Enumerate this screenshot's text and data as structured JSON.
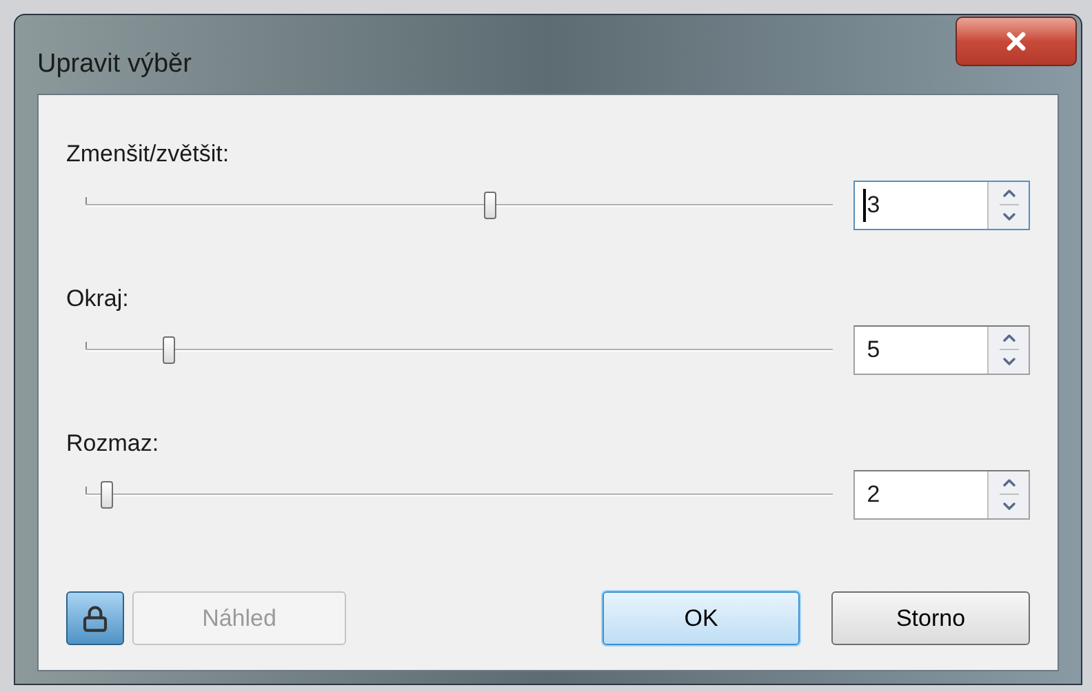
{
  "window": {
    "title": "Upravit výběr"
  },
  "sliders": [
    {
      "label": "Zmenšit/zvětšit:",
      "level": 0.525,
      "value": "3",
      "focused": true
    },
    {
      "label": "Okraj:",
      "level": 0.107,
      "value": "5",
      "focused": false
    },
    {
      "label": "Rozmaz:",
      "level": 0.027,
      "value": "2",
      "focused": false
    }
  ],
  "lock": {
    "on": true
  },
  "preview": {
    "label": "Náhled",
    "disabled": true
  },
  "ok": {
    "label": "OK",
    "default": true
  },
  "cancel": {
    "label": "Storno",
    "default": false
  }
}
